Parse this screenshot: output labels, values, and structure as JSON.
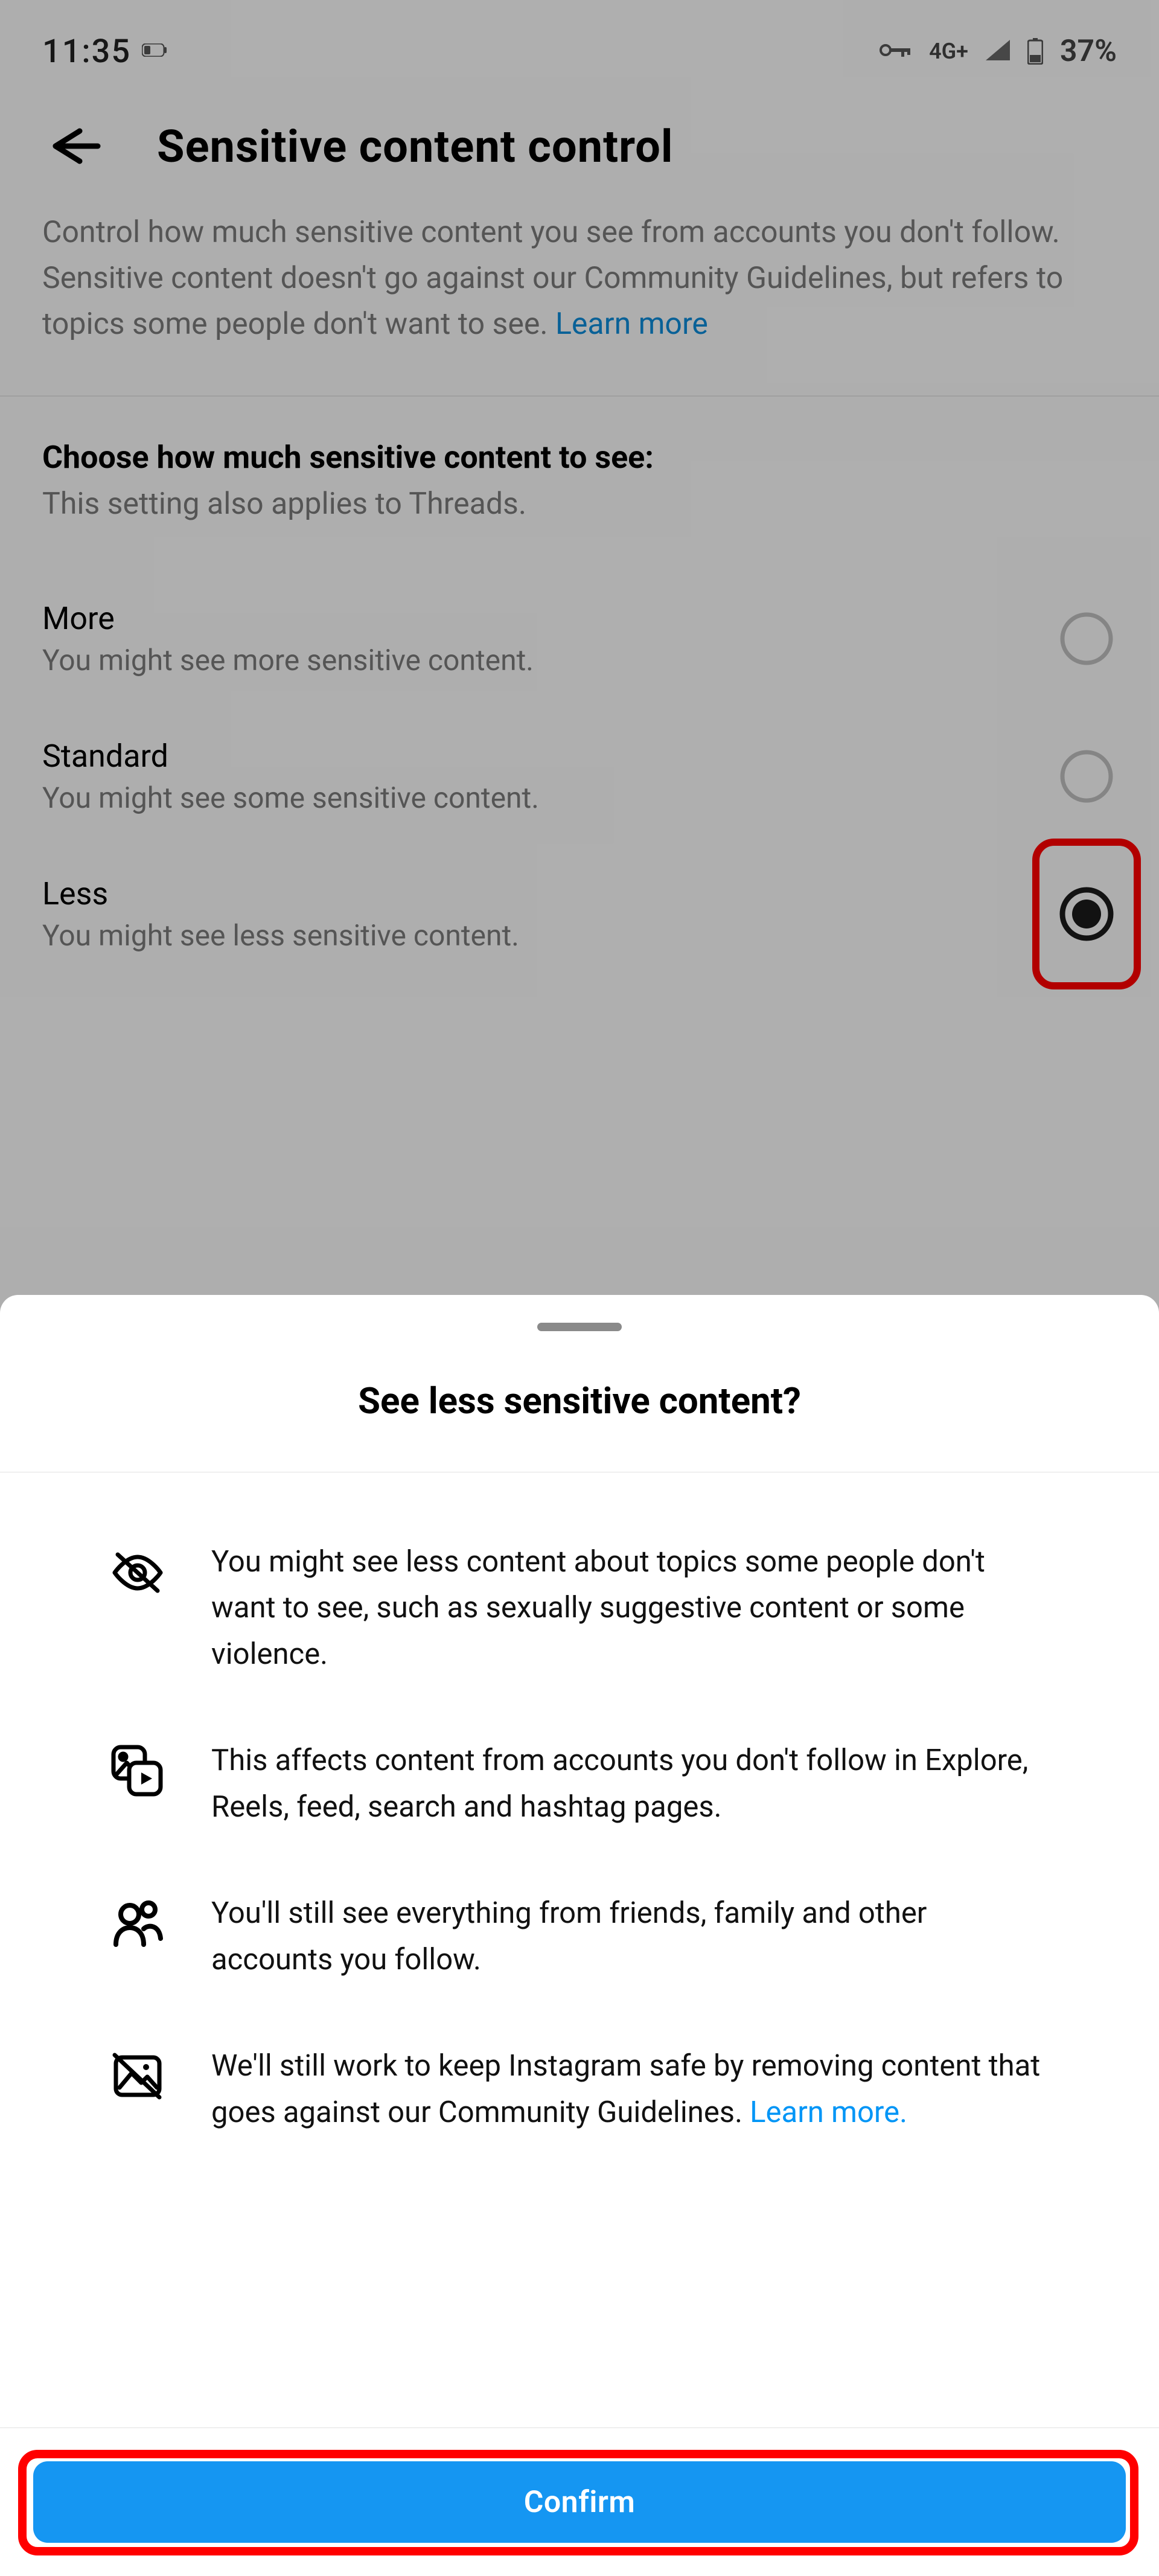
{
  "status_bar": {
    "time": "11:35",
    "network_label": "4G+",
    "battery_label": "37%"
  },
  "bg": {
    "page_title": "Sensitive content control",
    "intro_text": "Control how much sensitive content you see from accounts you don't follow. Sensitive content doesn't go against our Community Guidelines, but refers to topics some people don't want to see. ",
    "intro_link": "Learn more",
    "options_heading": "Choose how much sensitive content to see:",
    "options_sub": "This setting also applies to Threads.",
    "options": [
      {
        "label": "More",
        "desc": "You might see more sensitive content.",
        "selected": false
      },
      {
        "label": "Standard",
        "desc": "You might see some sensitive content.",
        "selected": false
      },
      {
        "label": "Less",
        "desc": "You might see less sensitive content.",
        "selected": true
      }
    ]
  },
  "sheet": {
    "title": "See less sensitive content?",
    "bullets": [
      {
        "icon": "eye-off-icon",
        "text": "You might see less content about topics some people don't want to see, such as sexually suggestive content or some violence."
      },
      {
        "icon": "media-play-icon",
        "text": "This affects content from accounts you don't follow in Explore, Reels, feed, search and hashtag pages."
      },
      {
        "icon": "people-icon",
        "text": "You'll still see everything from friends, family and other accounts you follow."
      },
      {
        "icon": "image-blocked-icon",
        "text": "We'll still work to keep Instagram safe by removing content that goes against our Community Guidelines. ",
        "link_text": "Learn more."
      }
    ],
    "confirm": "Confirm"
  }
}
